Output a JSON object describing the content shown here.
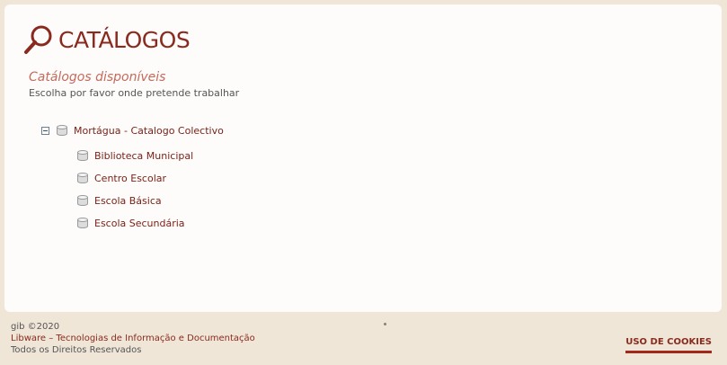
{
  "header": {
    "title": "CATÁLOGOS",
    "icon": "search-icon"
  },
  "section": {
    "subtitle": "Catálogos disponíveis",
    "instruction": "Escolha por favor onde pretende trabalhar"
  },
  "tree": {
    "root_label": "Mortágua - Catalogo Colectivo",
    "children": [
      {
        "label": "Biblioteca Municipal"
      },
      {
        "label": "Centro Escolar"
      },
      {
        "label": "Escola Básica"
      },
      {
        "label": "Escola Secundária"
      }
    ]
  },
  "footer": {
    "line1": "gib ©2020",
    "link": "Libware – Tecnologias de Informação e Documentação",
    "line3": "Todos os Direitos Reservados",
    "cookies": "USO DE COOKIES"
  },
  "colors": {
    "accent": "#8a2a1e",
    "background": "#efe6d7",
    "panel": "#fdfcfb"
  }
}
